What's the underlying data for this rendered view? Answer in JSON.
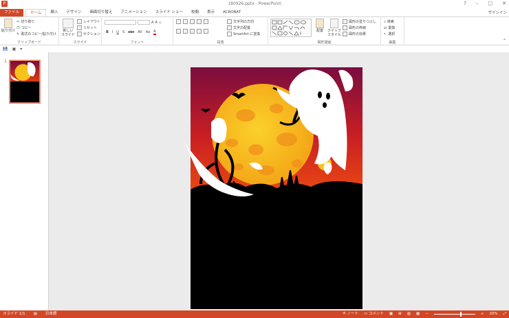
{
  "titlebar": {
    "title": "180926.pptx - PowerPoint",
    "app_icon": "P"
  },
  "tabs": [
    "ファイル",
    "ホーム",
    "挿入",
    "デザイン",
    "画面切り替え",
    "アニメーション",
    "スライド ショー",
    "校閲",
    "表示",
    "ACROBAT"
  ],
  "active_tab": "ホーム",
  "signin": "サインイン",
  "ribbon": {
    "clipboard": {
      "label": "クリップボード",
      "paste": "貼り付け",
      "cut": "切り取り",
      "copy": "コピー",
      "format_painter": "書式のコピー/貼り付け"
    },
    "slides": {
      "label": "スライド",
      "new_slide": "新しい\nスライド",
      "layout": "レイアウト",
      "reset": "リセット",
      "section": "セクション"
    },
    "font": {
      "label": "フォント",
      "font_name": "",
      "font_size": "",
      "buttons": [
        "B",
        "I",
        "U",
        "S",
        "abc",
        "AV",
        "Aa",
        "A"
      ]
    },
    "paragraph": {
      "label": "段落",
      "text_direction": "文字列の方向",
      "align_text": "文字の配置",
      "smartart": "SmartArt に変換"
    },
    "drawing": {
      "label": "図形描画",
      "arrange": "配置",
      "quick_styles": "クイック\nスタイル",
      "shape_fill": "図形の塗りつぶし",
      "shape_outline": "図形の枠線",
      "shape_effects": "図形の効果"
    },
    "editing": {
      "label": "編集",
      "find": "検索",
      "replace": "置換",
      "select": "選択"
    }
  },
  "thumbnail": {
    "number": "1"
  },
  "statusbar": {
    "slide": "スライド 1/1",
    "language": "日本語",
    "notes": "ノート",
    "comments": "コメント",
    "zoom": "20%"
  },
  "colors": {
    "accent": "#d24726",
    "sky_top": "#7a0d3e",
    "sky_bottom": "#e23a12",
    "moon": "#f7c21d",
    "moon_spot": "#f39c12"
  }
}
